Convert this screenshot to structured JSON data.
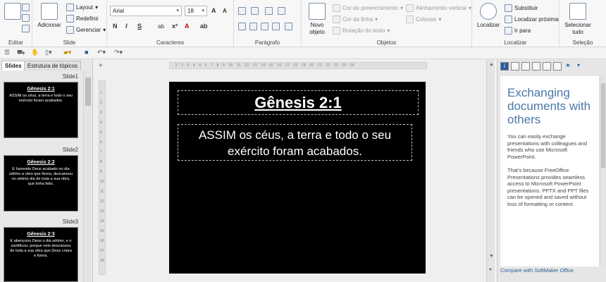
{
  "ribbon": {
    "editar": {
      "label": "Editar"
    },
    "slide": {
      "label": "Slide",
      "adicionar": "Adicionar",
      "layout": "Layout",
      "redefinir": "Redefinir",
      "gerenciar": "Gerenciar"
    },
    "caracteres": {
      "label": "Caracteres",
      "font": "Arial",
      "size": "18",
      "bold": "N",
      "italic": "I",
      "underline": "S",
      "strike": "ab"
    },
    "paragrafo": {
      "label": "Parágrafo"
    },
    "objetos": {
      "label": "Objetos",
      "novo_objeto": "Novo objeto",
      "cor_preenchimento": "Cor de preenchimento",
      "cor_linha": "Cor da linha",
      "rotacao": "Rotação do texto",
      "alinhamento": "Alinhamento vertical",
      "colunas": "Colunas"
    },
    "localizar": {
      "label": "Localizar",
      "localizar": "Localizar",
      "substituir": "Substituir",
      "localizar_proxima": "Localizar próxima",
      "ir_para": "Ir para"
    },
    "selecao": {
      "label": "Seleção",
      "selecionar_tudo": "Selecionar tudo"
    }
  },
  "left_panel": {
    "tabs": [
      "Slides",
      "Estrutura de tópicos"
    ],
    "slides": [
      {
        "label": "Slide1",
        "title": "Gênesis 2:1",
        "body": "ASSIM os céus, a terra e todo o seu exército foram acabados."
      },
      {
        "label": "Slide2",
        "title": "Gênesis 2:2",
        "body": "E havendo Deus acabado no dia sétimo a obra que fizera, descansou no sétimo dia de toda a sua obra, que tinha feito."
      },
      {
        "label": "Slide3",
        "title": "Gênesis 2:3",
        "body": "E abençoou Deus o dia sétimo, e o santificou; porque nele descansou de toda a sua obra que Deus criara e fizera."
      }
    ]
  },
  "slide": {
    "title": "Gênesis 2:1",
    "body": "ASSIM os céus, a terra e todo o seu exército foram acabados."
  },
  "right_panel": {
    "title": "Exchanging documents with others",
    "p1": "You can easily exchange presentations with colleagues and friends who use Microsoft PowerPoint.",
    "p2": "That's because FreeOffice Presentations provides seamless access to Microsoft PowerPoint presentations: PPTX and PPT files can be opened and saved without loss of formatting or content.",
    "link": "Compare with SoftMaker Office"
  },
  "colors": {
    "accent": "#4b78a8",
    "link": "#2a5d9a",
    "slide_bg": "#000000"
  }
}
